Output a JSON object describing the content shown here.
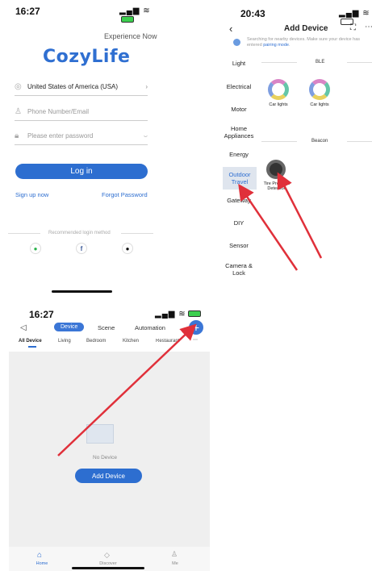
{
  "panel1": {
    "time": "16:27",
    "experience_now": "Experience Now",
    "logo": "CozyLife",
    "country": "United States of America (USA)",
    "phone_placeholder": "Phone Number/Email",
    "password_placeholder": "Please enter password",
    "login_label": "Log in",
    "signup_label": "Sign up now",
    "forgot_label": "Forgot Password",
    "recommended_label": "Recommended login method"
  },
  "panel2": {
    "time": "20:43",
    "title": "Add Device",
    "searching_text": "Searching for nearby devices. Make sure your device has entered",
    "pairing_mode": "pairing mode",
    "categories": [
      "Light",
      "Electrical",
      "Motor",
      "Home Appliances",
      "Energy",
      "Outdoor Travel",
      "Gateway",
      "DIY",
      "Sensor",
      "Camera & Lock"
    ],
    "selected_category": "Outdoor Travel",
    "ble_header": "BLE",
    "beacon_header": "Beacon",
    "devices": [
      "Car lights",
      "Car lights",
      "Tire Pressure Detection"
    ]
  },
  "panel3": {
    "time": "16:27",
    "tabs": [
      "Device",
      "Scene",
      "Automation"
    ],
    "rooms": [
      "All Device",
      "Living",
      "Bedroom",
      "Kitchen",
      "Restaurant"
    ],
    "no_device": "No Device",
    "add_device": "Add Device",
    "nav": [
      "Home",
      "Discover",
      "Me"
    ]
  },
  "colors": {
    "accent": "#2d6ed0",
    "arrow": "#e0303a",
    "selected_bg": "#dfe5ee"
  }
}
